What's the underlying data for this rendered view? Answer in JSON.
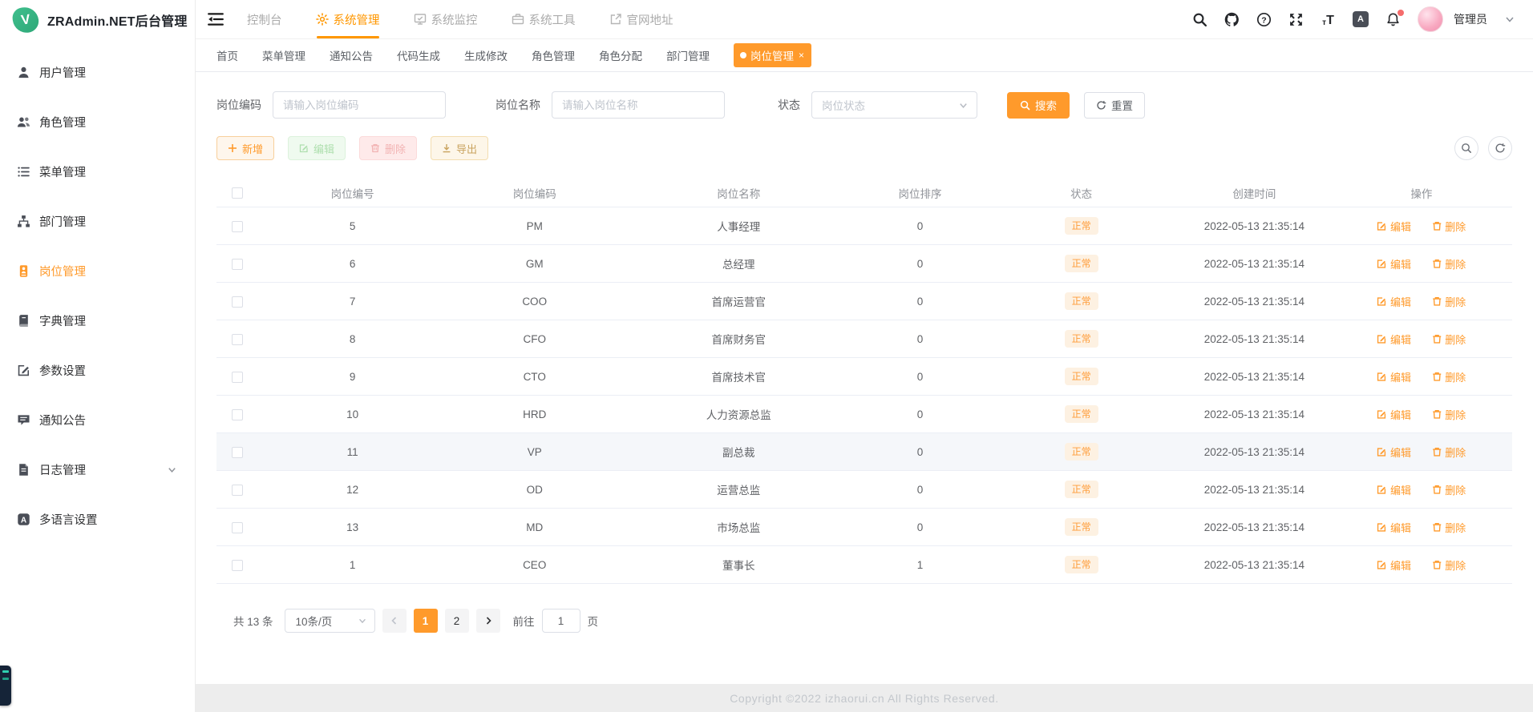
{
  "app": {
    "logo_letter": "V",
    "title": "ZRAdmin.NET后台管理"
  },
  "header": {
    "nav": [
      {
        "label": "控制台",
        "active": false
      },
      {
        "label": "系统管理",
        "active": true
      },
      {
        "label": "系统监控",
        "active": false
      },
      {
        "label": "系统工具",
        "active": false
      },
      {
        "label": "官网地址",
        "active": false
      }
    ],
    "icons": [
      "search-icon",
      "github-icon",
      "help-icon",
      "fullscreen-icon",
      "font-size-icon",
      "language-icon",
      "bell-icon"
    ],
    "font_size_icon_text": "тT",
    "language_icon_text": "A",
    "user_name": "管理员"
  },
  "sidebar": {
    "items": [
      {
        "label": "用户管理",
        "icon": "user-icon",
        "active": false
      },
      {
        "label": "角色管理",
        "icon": "users-icon",
        "active": false
      },
      {
        "label": "菜单管理",
        "icon": "menu-list-icon",
        "active": false
      },
      {
        "label": "部门管理",
        "icon": "department-tree-icon",
        "active": false
      },
      {
        "label": "岗位管理",
        "icon": "post-badge-icon",
        "active": true
      },
      {
        "label": "字典管理",
        "icon": "dictionary-book-icon",
        "active": false
      },
      {
        "label": "参数设置",
        "icon": "edit-square-icon",
        "active": false
      },
      {
        "label": "通知公告",
        "icon": "message-icon",
        "active": false
      },
      {
        "label": "日志管理",
        "icon": "document-log-icon",
        "active": false,
        "has_children": true
      },
      {
        "label": "多语言设置",
        "icon": "language-square-icon",
        "active": false
      }
    ]
  },
  "tabbar": {
    "tabs": [
      {
        "label": "首页",
        "active": false
      },
      {
        "label": "菜单管理",
        "active": false
      },
      {
        "label": "通知公告",
        "active": false
      },
      {
        "label": "代码生成",
        "active": false
      },
      {
        "label": "生成修改",
        "active": false
      },
      {
        "label": "角色管理",
        "active": false
      },
      {
        "label": "角色分配",
        "active": false
      },
      {
        "label": "部门管理",
        "active": false
      },
      {
        "label": "岗位管理",
        "active": true,
        "close_glyph": "×"
      }
    ]
  },
  "filters": {
    "code_label": "岗位编码",
    "code_placeholder": "请输入岗位编码",
    "name_label": "岗位名称",
    "name_placeholder": "请输入岗位名称",
    "status_label": "状态",
    "status_placeholder": "岗位状态",
    "search_label": "搜索",
    "reset_label": "重置"
  },
  "toolbar": {
    "add_label": "新增",
    "edit_label": "编辑",
    "delete_label": "删除",
    "export_label": "导出"
  },
  "table": {
    "headers": [
      "岗位编号",
      "岗位编码",
      "岗位名称",
      "岗位排序",
      "状态",
      "创建时间",
      "操作"
    ],
    "action_edit": "编辑",
    "action_delete": "删除",
    "rows": [
      {
        "id": "5",
        "code": "PM",
        "name": "人事经理",
        "sort": "0",
        "status": "正常",
        "created": "2022-05-13 21:35:14"
      },
      {
        "id": "6",
        "code": "GM",
        "name": "总经理",
        "sort": "0",
        "status": "正常",
        "created": "2022-05-13 21:35:14"
      },
      {
        "id": "7",
        "code": "COO",
        "name": "首席运营官",
        "sort": "0",
        "status": "正常",
        "created": "2022-05-13 21:35:14"
      },
      {
        "id": "8",
        "code": "CFO",
        "name": "首席财务官",
        "sort": "0",
        "status": "正常",
        "created": "2022-05-13 21:35:14"
      },
      {
        "id": "9",
        "code": "CTO",
        "name": "首席技术官",
        "sort": "0",
        "status": "正常",
        "created": "2022-05-13 21:35:14"
      },
      {
        "id": "10",
        "code": "HRD",
        "name": "人力资源总监",
        "sort": "0",
        "status": "正常",
        "created": "2022-05-13 21:35:14"
      },
      {
        "id": "11",
        "code": "VP",
        "name": "副总裁",
        "sort": "0",
        "status": "正常",
        "created": "2022-05-13 21:35:14",
        "highlighted": true
      },
      {
        "id": "12",
        "code": "OD",
        "name": "运营总监",
        "sort": "0",
        "status": "正常",
        "created": "2022-05-13 21:35:14"
      },
      {
        "id": "13",
        "code": "MD",
        "name": "市场总监",
        "sort": "0",
        "status": "正常",
        "created": "2022-05-13 21:35:14"
      },
      {
        "id": "1",
        "code": "CEO",
        "name": "董事长",
        "sort": "1",
        "status": "正常",
        "created": "2022-05-13 21:35:14"
      }
    ]
  },
  "pagination": {
    "total_text": "共 13 条",
    "page_size_text": "10条/页",
    "page_1": "1",
    "page_2": "2",
    "goto_label": "前往",
    "goto_value": "1",
    "page_unit": "页"
  },
  "footer": {
    "copyright": "Copyright ©2022 izhaorui.cn All Rights Reserved."
  },
  "colors": {
    "primary_orange": "#ff9a2b",
    "nav_active_orange": "#ff9700",
    "logo_green": "#35b584",
    "status_badge_bg": "#fdf1e2",
    "status_badge_text": "#ff9c38",
    "disabled_green": "#aedfae",
    "disabled_red": "#f2b3b3",
    "export_gold": "#c9a35e",
    "footer_bg": "#ededed",
    "footer_text": "#c3c7cc",
    "notification_dot": "#f56c6c"
  }
}
